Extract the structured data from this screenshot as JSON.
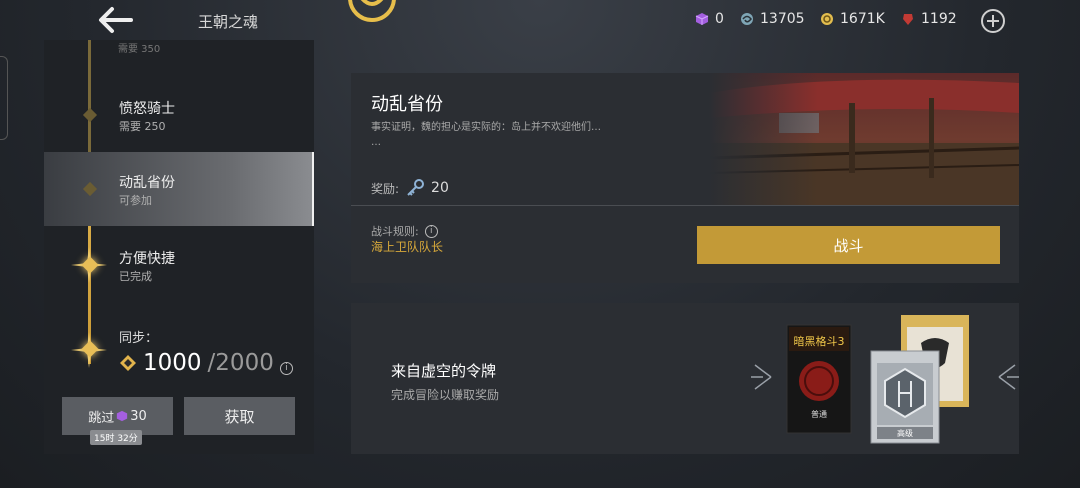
{
  "header": {
    "title": "王朝之魂",
    "resources": [
      {
        "name": "purple-cube",
        "value": "0",
        "color": "#b46be6"
      },
      {
        "name": "swirl",
        "value": "13705",
        "color": "#8fb8c8"
      },
      {
        "name": "gold-coin",
        "value": "1671K",
        "color": "#e7c35a"
      },
      {
        "name": "red-gem",
        "value": "1192",
        "color": "#c9413b"
      }
    ]
  },
  "stages": {
    "cut_top": "需要 350",
    "items": [
      {
        "name": "愤怒骑士",
        "sub": "需要 250"
      },
      {
        "name": "动乱省份",
        "sub": "可参加"
      },
      {
        "name": "方便快捷",
        "sub": "已完成"
      }
    ]
  },
  "sync": {
    "label": "同步：",
    "current": "1000",
    "max": "/2000",
    "info": "i"
  },
  "buttons": {
    "skip_label": "跳过",
    "skip_cost": "30",
    "skip_timer": "15时 32分",
    "get_label": "获取",
    "fight_label": "战斗"
  },
  "mission": {
    "title": "动乱省份",
    "desc": "事实证明，魏的担心是实际的：岛上并不欢迎他们…",
    "desc_more": "…",
    "reward_label": "奖励:",
    "reward_value": "20",
    "rule_label": "战斗规则:",
    "rule_value": "海上卫队队长",
    "rule_info": "i"
  },
  "token": {
    "title": "来自虚空的令牌",
    "subtitle": "完成冒险以赚取奖励",
    "card_common_label": "普通",
    "card_advanced_label": "高级",
    "card_game_title": "暗黑格斗3"
  }
}
